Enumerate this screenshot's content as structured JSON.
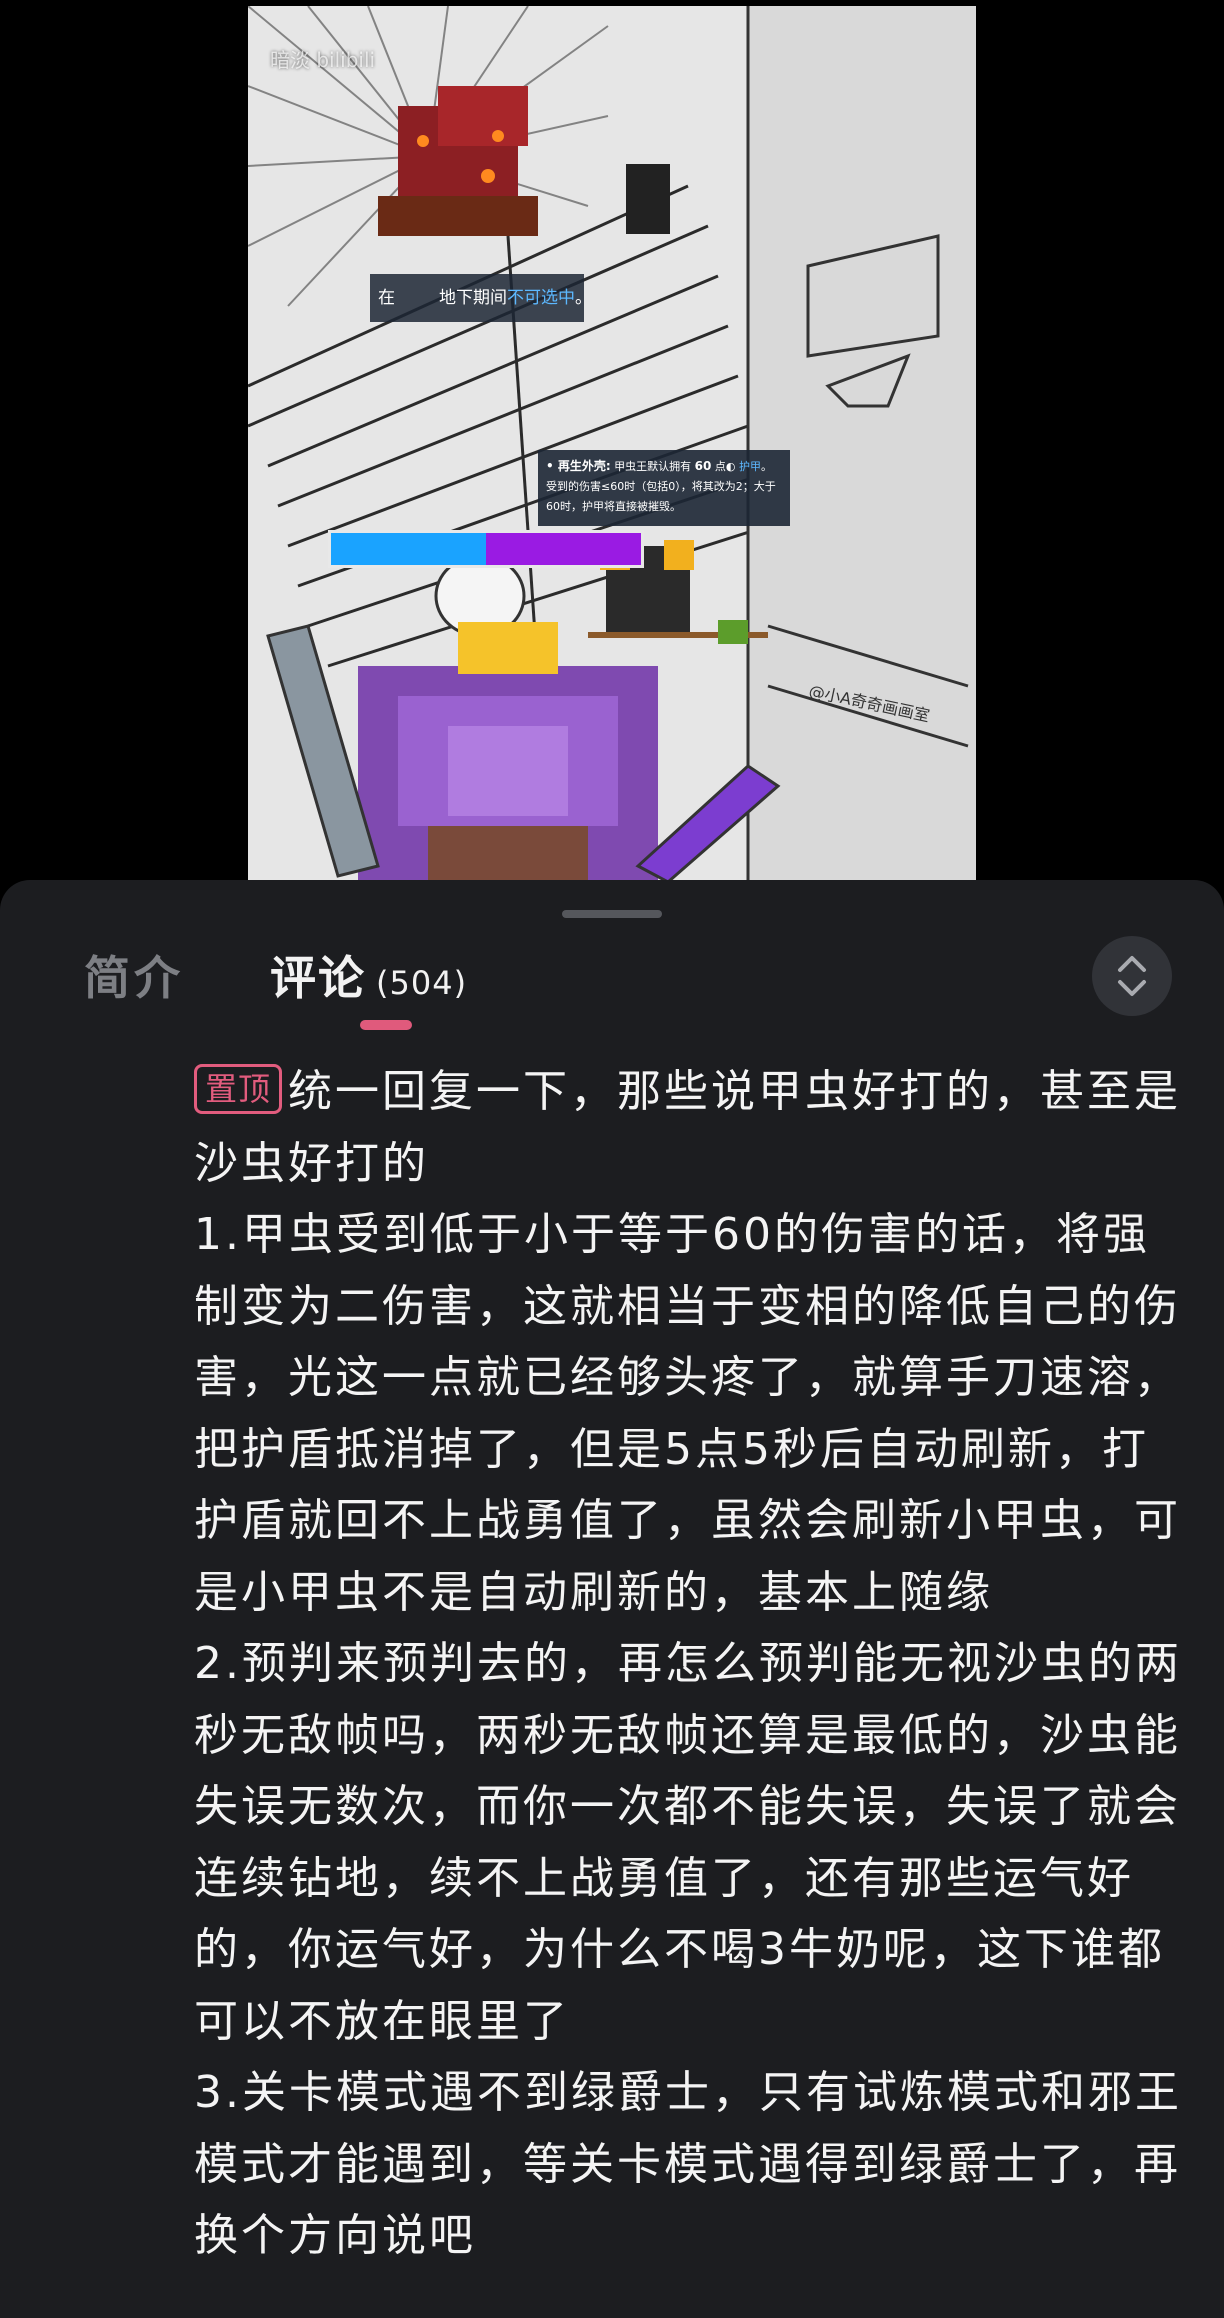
{
  "video": {
    "watermark": "暗淡 bilibili",
    "tip_top": {
      "prefix": "在",
      "middle": "地下期间",
      "highlight": "不可选中",
      "suffix": "。"
    },
    "tip_shell": {
      "title": "• 再生外壳:",
      "line1_a": "甲虫王默认拥有",
      "line1_num": "60",
      "line1_b": "点",
      "line1_hl": "护甲",
      "line1_end": "。",
      "line2": "受到的伤害≤60时（包括0），将其改为2；大于",
      "line3": "60时，护甲将直接被摧毁。"
    },
    "hp_colors": {
      "shield": "#1aa3ff",
      "health": "#9a1be3"
    }
  },
  "tabs": {
    "intro_label": "简介",
    "comments_label": "评论",
    "comments_count": "(504)"
  },
  "comment": {
    "pinned_badge": "置顶",
    "text": "统一回复一下，那些说甲虫好打的，甚至是沙虫好打的\n1.甲虫受到低于小于等于60的伤害的话，将强制变为二伤害，这就相当于变相的降低自己的伤害，光这一点就已经够头疼了，就算手刀速溶，把护盾抵消掉了，但是5点5秒后自动刷新，打护盾就回不上战勇值了，虽然会刷新小甲虫，可是小甲虫不是自动刷新的，基本上随缘\n2.预判来预判去的，再怎么预判能无视沙虫的两秒无敌帧吗，两秒无敌帧还算是最低的，沙虫能失误无数次，而你一次都不能失误，失误了就会连续钻地，续不上战勇值了，还有那些运气好的，你运气好，为什么不喝3牛奶呢，这下谁都可以不放在眼里了\n3.关卡模式遇不到绿爵士，只有试炼模式和邪王模式才能遇到，等关卡模式遇得到绿爵士了，再换个方向说吧"
  },
  "colors": {
    "accent": "#e25c7e",
    "sheet_bg": "#1c1d20",
    "text": "#f4f4f4",
    "tab_inactive": "#7d7f84"
  },
  "icons": {
    "expand": "chevron-up-down-icon"
  }
}
